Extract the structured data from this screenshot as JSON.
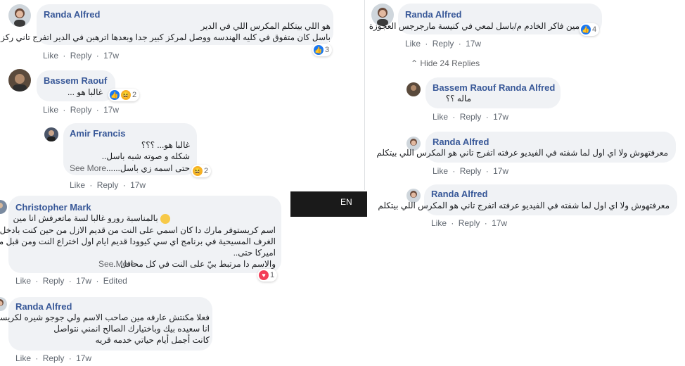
{
  "actions": {
    "like": "Like",
    "reply": "Reply",
    "edited": "Edited",
    "sep": "·"
  },
  "language": "EN",
  "panel_a": {
    "c1": {
      "author": "Randa Alfred",
      "lines": [
        "هو اللي بيتكلم المكرس اللي في الدير",
        "باسل كان متفوق في كليه الهندسه ووصل لمركز كبير جدا وبعدها اترهبن في الدير اتفرج تاني ركز"
      ],
      "time": "17w",
      "reaction_count": "3"
    },
    "c2": {
      "author": "Bassem Raouf",
      "lines": [
        "غالبا هو ..."
      ],
      "time": "17w",
      "reaction_count": "2"
    },
    "c3": {
      "author": "Amir Francis",
      "lines": [
        "غالبا هو... ؟؟؟",
        "شكله و صوته شبه باسل..",
        "حتى اسمه زي باسل......"
      ],
      "see_more": "See More",
      "time": "17w",
      "reaction_count": "2"
    }
  },
  "panel_b": {
    "c1": {
      "author": "Christopher Mark",
      "lines": [
        "بالمناسبة رورو غالبا لسة ماتعرفش انا مين",
        "اسم كريستوفر مارك دا كان اسمي على النت من قديم الازل من حين كنت بادخل في",
        "الغرف المسيحية في برنامج اي سي كيوودا قديم ايام اول اختراع النت ومن قبل ما اسافر",
        "اميركا حتى..",
        "والاسم دا مرتبط بيّ على النت في كل محافل ..."
      ],
      "see_more": "See More",
      "time": "17w",
      "edited": "Edited",
      "reaction_count": "1"
    },
    "c2": {
      "author": "Randa Alfred",
      "lines": [
        "فعلا مكنتش عارفه مين صاحب الاسم ولي جوجو شيره لكريستوفر",
        "انا سعيده بيك وباختيارك الصالح انمني نتواصل",
        "كانت أجمل أيام حياتي خدمه قريه"
      ],
      "time": "17w"
    }
  },
  "panel_c": {
    "c1": {
      "author": "Randa Alfred",
      "lines": [
        "مين فاكر الخادم م/باسل لمعي في كنيسة مارجرجس العجوزة"
      ],
      "time": "17w",
      "reaction_count": "4"
    },
    "hide_replies": "Hide 24 Replies",
    "r1": {
      "author": "Bassem Raouf",
      "reply_to": "Randa Alfred",
      "lines": [
        "ماله ؟؟"
      ],
      "time": "17w"
    },
    "r2": {
      "author": "Randa Alfred",
      "lines": [
        "معرفتهوش ولا اي اول لما شفته في الفيديو عرفته اتفرج تاني هو المكرس اللي بيتكلم"
      ],
      "time": "17w"
    },
    "r3": {
      "author": "Randa Alfred",
      "lines": [
        "معرفتهوش ولا اي اول لما شفته في الفيديو عرفته اتفرج تاني هو المكرس اللي بيتكلم"
      ],
      "time": "17w"
    }
  },
  "colors": {
    "name": "#385898",
    "bubble": "#f0f2f5",
    "like": "#1877f2",
    "haha": "#f7b125",
    "love": "#f33e58"
  }
}
